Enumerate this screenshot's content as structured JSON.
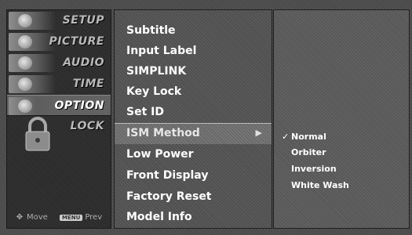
{
  "categories": [
    {
      "label": "SETUP",
      "icon": "setup-icon"
    },
    {
      "label": "PICTURE",
      "icon": "picture-icon"
    },
    {
      "label": "AUDIO",
      "icon": "audio-icon"
    },
    {
      "label": "TIME",
      "icon": "time-icon"
    },
    {
      "label": "OPTION",
      "icon": "option-icon",
      "active": true
    },
    {
      "label": "LOCK",
      "icon": "lock-icon"
    }
  ],
  "footer": {
    "move_label": "Move",
    "menu_key": "MENU",
    "prev_label": "Prev"
  },
  "menu_items": [
    {
      "label": "Subtitle"
    },
    {
      "label": "Input Label"
    },
    {
      "label": "SIMPLINK"
    },
    {
      "label": "Key Lock"
    },
    {
      "label": "Set ID"
    },
    {
      "label": "ISM Method",
      "selected": true,
      "has_submenu": true
    },
    {
      "label": "Low Power"
    },
    {
      "label": "Front Display"
    },
    {
      "label": "Factory Reset"
    },
    {
      "label": "Model Info"
    }
  ],
  "submenu_arrow": "▶",
  "ism_options": [
    {
      "label": "Normal",
      "checked": true
    },
    {
      "label": "Orbiter"
    },
    {
      "label": "Inversion"
    },
    {
      "label": "White Wash"
    }
  ],
  "check_mark": "✓",
  "colors": {
    "background": "#4a4a4a",
    "active_category": "#626262",
    "selected_item": "#6a6a6a",
    "text": "#ffffff",
    "category_text": "#b9b9b9"
  }
}
